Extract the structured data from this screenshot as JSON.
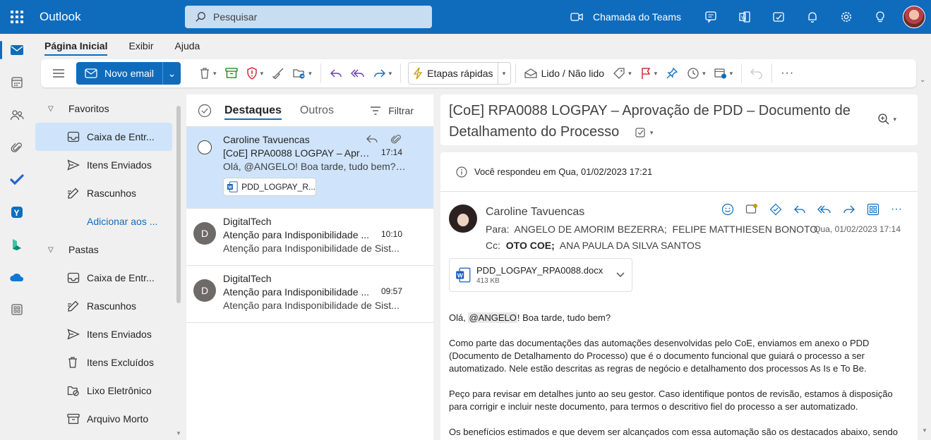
{
  "app": {
    "name": "Outlook"
  },
  "search": {
    "placeholder": "Pesquisar"
  },
  "topbar": {
    "teams_label": "Chamada do Teams"
  },
  "ribbon": {
    "tabs": [
      "Página Inicial",
      "Exibir",
      "Ajuda"
    ]
  },
  "toolbar": {
    "new_mail": "Novo email",
    "quick_steps": "Etapas rápidas",
    "read_unread": "Lido / Não lido"
  },
  "folders": {
    "favorites_label": "Favoritos",
    "favorites": [
      "Caixa de Entr...",
      "Itens Enviados",
      "Rascunhos"
    ],
    "add_favorite": "Adicionar aos ...",
    "folders_label": "Pastas",
    "items": [
      "Caixa de Entr...",
      "Rascunhos",
      "Itens Enviados",
      "Itens Excluídos",
      "Lixo Eletrônico",
      "Arquivo Morto"
    ]
  },
  "message_list": {
    "tabs": {
      "focused": "Destaques",
      "other": "Outros"
    },
    "filter": "Filtrar",
    "messages": [
      {
        "sender": "Caroline Tavuencas",
        "subject": "[CoE] RPA0088 LOGPAY – Aprov...",
        "time": "17:14",
        "preview": "Olá, @ANGELO! Boa tarde, tudo bem? ...",
        "attachment": "PDD_LOGPAY_R..."
      },
      {
        "initial": "D",
        "sender": "DigitalTech",
        "subject": "Atenção para Indisponibilidade ...",
        "time": "10:10",
        "preview": "Atenção para Indisponibilidade de Sist..."
      },
      {
        "initial": "D",
        "sender": "DigitalTech",
        "subject": "Atenção para Indisponibilidade ...",
        "time": "09:57",
        "preview": "Atenção para Indisponibilidade de Sist..."
      }
    ]
  },
  "reading": {
    "title": "[CoE] RPA0088 LOGPAY – Aprovação de PDD – Documento de Detalhamento do Processo",
    "replied_info": "Você respondeu em Qua, 01/02/2023 17:21",
    "sender": "Caroline Tavuencas",
    "to_label": "Para:",
    "to": "ANGELO DE AMORIM BEZERRA;  FELIPE MATTHIESEN BONOTO",
    "cc_label": "Cc:",
    "cc_bold": "OTO COE;",
    "cc_rest": "ANA PAULA DA SILVA SANTOS",
    "date": "Qua, 01/02/2023 17:14",
    "attachment_name": "PDD_LOGPAY_RPA0088.docx",
    "attachment_size": "413 KB",
    "greeting_pre": "Olá, ",
    "greeting_mention": "@ANGELO",
    "greeting_post": "! Boa tarde, tudo bem?",
    "p1": "Como parte das documentações das automações desenvolvidas pelo CoE, enviamos em anexo o PDD (Documento de Detalhamento do Processo) que é o documento funcional que guiará o processo a ser automatizado. Nele estão descritas as regras de negócio e detalhamento dos processos As Is e To Be.",
    "p2": "Peço para revisar em detalhes junto ao seu gestor. Caso identifique pontos de revisão, estamos à disposição para corrigir e incluir neste documento, para termos o descritivo fiel do processo a ser automatizado.",
    "p3": "Os benefícios estimados e que devem ser alcançados com essa automação são os destacados abaixo, sendo"
  },
  "colors": {
    "brand": "#0f6cbd",
    "selected": "#cfe4fa"
  }
}
